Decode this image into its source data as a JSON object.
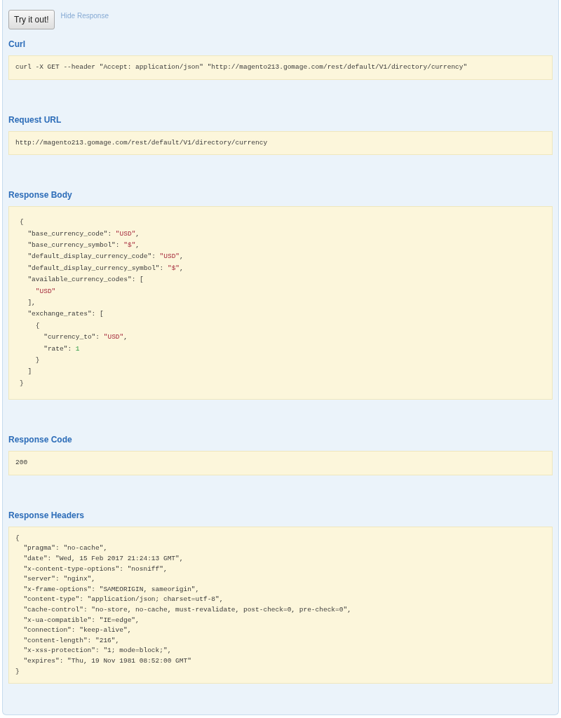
{
  "actions": {
    "try_button": "Try it out!",
    "hide_link": "Hide Response"
  },
  "sections": [
    {
      "kind": "plain",
      "heading": "Curl",
      "lines": [
        "curl -X GET --header \"Accept: application/json\" \"http://magento213.gomage.com/rest/default/V1/directory/currency\""
      ]
    },
    {
      "kind": "plain",
      "heading": "Request URL",
      "lines": [
        "http://magento213.gomage.com/rest/default/V1/directory/currency"
      ]
    },
    {
      "kind": "highlighted",
      "heading": "Response Body",
      "lines": [
        [
          {
            "kind": "plain",
            "text": "{"
          }
        ],
        [
          {
            "kind": "plain",
            "text": "  \"base_currency_code\": "
          },
          {
            "kind": "string",
            "text": "\"USD\""
          },
          {
            "kind": "plain",
            "text": ","
          }
        ],
        [
          {
            "kind": "plain",
            "text": "  \"base_currency_symbol\": "
          },
          {
            "kind": "string",
            "text": "\"$\""
          },
          {
            "kind": "plain",
            "text": ","
          }
        ],
        [
          {
            "kind": "plain",
            "text": "  \"default_display_currency_code\": "
          },
          {
            "kind": "string",
            "text": "\"USD\""
          },
          {
            "kind": "plain",
            "text": ","
          }
        ],
        [
          {
            "kind": "plain",
            "text": "  \"default_display_currency_symbol\": "
          },
          {
            "kind": "string",
            "text": "\"$\""
          },
          {
            "kind": "plain",
            "text": ","
          }
        ],
        [
          {
            "kind": "plain",
            "text": "  \"available_currency_codes\": ["
          }
        ],
        [
          {
            "kind": "string",
            "text": "    \"USD\""
          }
        ],
        [
          {
            "kind": "plain",
            "text": "  ],"
          }
        ],
        [
          {
            "kind": "plain",
            "text": "  \"exchange_rates\": ["
          }
        ],
        [
          {
            "kind": "plain",
            "text": "    {"
          }
        ],
        [
          {
            "kind": "plain",
            "text": "      \"currency_to\": "
          },
          {
            "kind": "string",
            "text": "\"USD\""
          },
          {
            "kind": "plain",
            "text": ","
          }
        ],
        [
          {
            "kind": "plain",
            "text": "      \"rate\": "
          },
          {
            "kind": "number",
            "text": "1"
          }
        ],
        [
          {
            "kind": "plain",
            "text": "    }"
          }
        ],
        [
          {
            "kind": "plain",
            "text": "  ]"
          }
        ],
        [
          {
            "kind": "plain",
            "text": "}"
          }
        ]
      ]
    },
    {
      "kind": "plain",
      "heading": "Response Code",
      "lines": [
        "200"
      ]
    },
    {
      "kind": "plain",
      "heading": "Response Headers",
      "lines": [
        "{",
        "  \"pragma\": \"no-cache\",",
        "  \"date\": \"Wed, 15 Feb 2017 21:24:13 GMT\",",
        "  \"x-content-type-options\": \"nosniff\",",
        "  \"server\": \"nginx\",",
        "  \"x-frame-options\": \"SAMEORIGIN, sameorigin\",",
        "  \"content-type\": \"application/json; charset=utf-8\",",
        "  \"cache-control\": \"no-store, no-cache, must-revalidate, post-check=0, pre-check=0\",",
        "  \"x-ua-compatible\": \"IE=edge\",",
        "  \"connection\": \"keep-alive\",",
        "  \"content-length\": \"216\",",
        "  \"x-xss-protection\": \"1; mode=block;\",",
        "  \"expires\": \"Thu, 19 Nov 1981 08:52:00 GMT\"",
        "}"
      ]
    }
  ]
}
